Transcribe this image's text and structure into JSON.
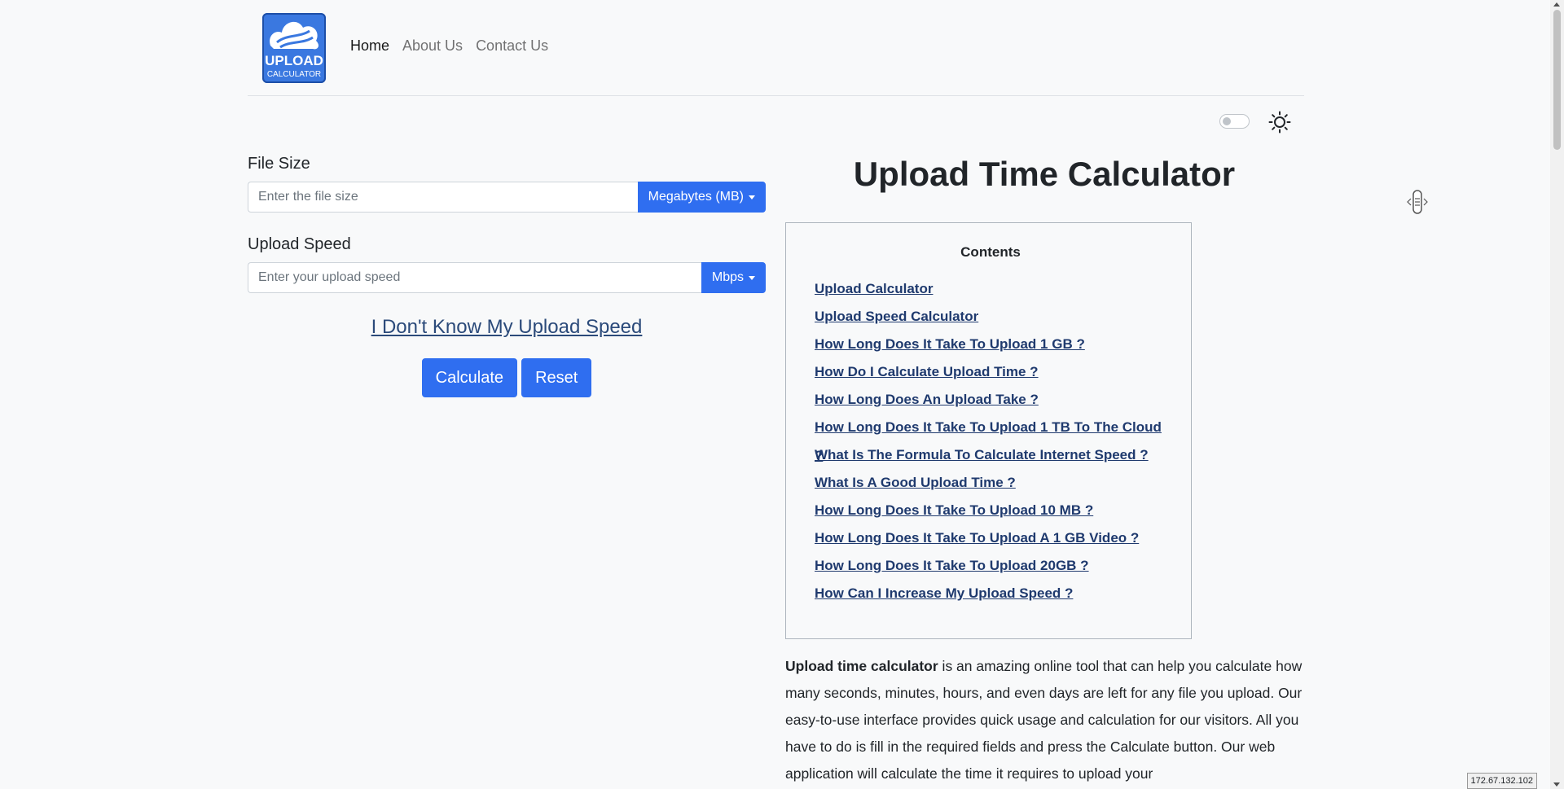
{
  "header": {
    "logo_text_top": "UPLOAD",
    "logo_text_bottom": "CALCULATOR",
    "nav": [
      {
        "label": "Home",
        "active": true
      },
      {
        "label": "About Us",
        "active": false
      },
      {
        "label": "Contact Us",
        "active": false
      }
    ]
  },
  "theme": {
    "toggle_icon": "toggle-switch",
    "sun_icon": "sun-icon"
  },
  "form": {
    "file_size": {
      "label": "File Size",
      "placeholder": "Enter the file size",
      "value": "",
      "unit": "Megabytes (MB)"
    },
    "upload_speed": {
      "label": "Upload Speed",
      "placeholder": "Enter your upload speed",
      "value": "",
      "unit": "Mbps"
    },
    "dont_know_link": "I Don't Know My Upload Speed",
    "calculate_label": "Calculate",
    "reset_label": "Reset"
  },
  "main": {
    "title": "Upload Time Calculator",
    "toc": {
      "title": "Contents",
      "items": [
        "Upload Calculator",
        "Upload Speed Calculator",
        "How Long Does It Take To Upload 1 GB ?",
        "How Do I Calculate Upload Time ?",
        "How Long Does An Upload Take ?",
        "How Long Does It Take To Upload 1 TB To The Cloud ?",
        "What Is The Formula To Calculate Internet Speed ?",
        "What Is A Good Upload Time ?",
        "How Long Does It Take To Upload 10 MB ?",
        "How Long Does It Take To Upload A 1 GB Video ?",
        "How Long Does It Take To Upload 20GB ?",
        "How Can I Increase My Upload Speed ?"
      ]
    },
    "intro_bold": "Upload time calculator",
    "intro_text": " is an amazing online tool that can help you calculate how many seconds, minutes, hours, and even days are left for any file you upload. Our easy-to-use interface provides quick usage and calculation for our visitors. All you have to do is fill in the required fields and press the Calculate button. Our web application will calculate the time it requires to upload your"
  },
  "status": {
    "ip": "172.67.132.102"
  },
  "colors": {
    "primary": "#2f6ef0",
    "link": "#1f3a6e",
    "background": "#f8f9fa"
  }
}
